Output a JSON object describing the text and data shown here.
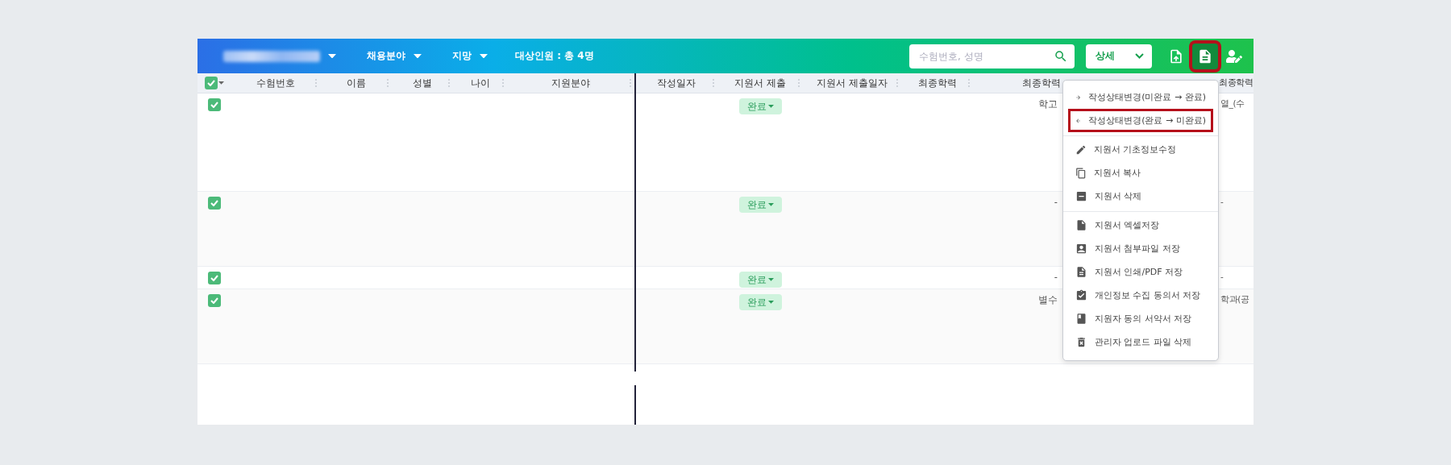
{
  "toolbar": {
    "filters": [
      {
        "kind": "blurred"
      },
      {
        "kind": "text",
        "label": "채용분야"
      },
      {
        "kind": "text",
        "label": "지망"
      }
    ],
    "count_label": "대상인원 : 총 4명",
    "search": {
      "placeholder": "수험번호, 성명"
    },
    "detail_select": {
      "value": "상세"
    },
    "tool_buttons": [
      {
        "selected": false,
        "highlighted": false
      },
      {
        "selected": true,
        "highlighted": true
      },
      {
        "selected": false,
        "highlighted": false
      }
    ]
  },
  "table": {
    "all_checked": true,
    "columns": [
      "수험번호",
      "이름",
      "성별",
      "나이",
      "지원분야",
      "작성일자",
      "지원서 제출",
      "지원서 제출일자",
      "최종학력",
      "최종학력",
      "최종학력"
    ],
    "rows": [
      {
        "checked": true,
        "status": "완료",
        "column_10": "학고",
        "column_11": "열_(수"
      },
      {
        "checked": true,
        "status": "완료",
        "column_10": "-",
        "column_11": "-"
      },
      {
        "checked": true,
        "status": "완료",
        "column_10": "-",
        "column_11": "-"
      },
      {
        "checked": true,
        "status": "완료",
        "column_10": "별수",
        "column_11": "학과(공"
      }
    ]
  },
  "menu": {
    "groups": [
      {
        "items": [
          {
            "label": "작성상태변경(미완료 → 완료)",
            "highlighted": false
          },
          {
            "label": "작성상태변경(완료 → 미완료)",
            "highlighted": true
          }
        ]
      },
      {
        "items": [
          {
            "label": "지원서 기초정보수정",
            "highlighted": false
          },
          {
            "label": "지원서 복사",
            "highlighted": false
          },
          {
            "label": "지원서 삭제",
            "highlighted": false
          }
        ]
      },
      {
        "items": [
          {
            "label": "지원서 엑셀저장",
            "highlighted": false
          },
          {
            "label": "지원서 첨부파일 저장",
            "highlighted": false
          },
          {
            "label": "지원서 인쇄/PDF 저장",
            "highlighted": false
          },
          {
            "label": "개인정보 수집 동의서 저장",
            "highlighted": false
          },
          {
            "label": "지원자 동의 서약서 저장",
            "highlighted": false
          },
          {
            "label": "관리자 업로드 파일 삭제",
            "highlighted": false
          }
        ]
      }
    ]
  }
}
